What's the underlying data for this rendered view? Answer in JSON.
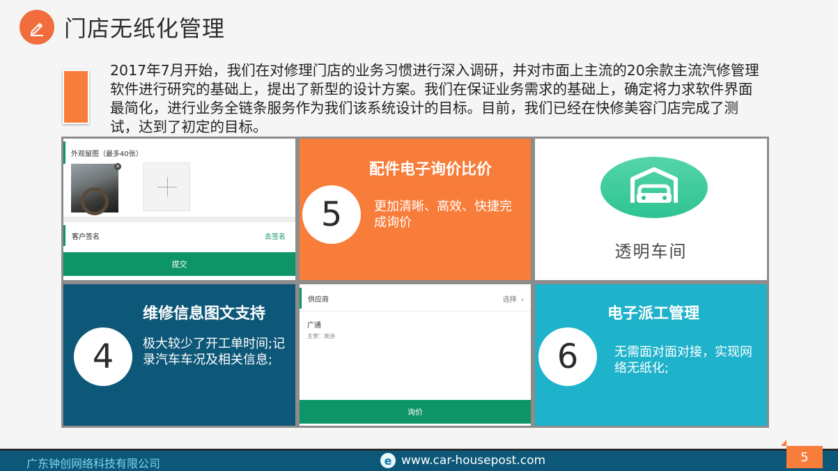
{
  "slide": {
    "title": "门店无纸化管理",
    "title_icon": "pencil-icon",
    "intro": "2017年7月开始，我们在对修理门店的业务习惯进行深入调研，并对市面上主流的20余款主流汽修管理软件进行研究的基础上，提出了新型的设计方案。我们在保证业务需求的基础上，确定将力求软件界面最简化，进行业务全链条服务作为我们该系统设计的目标。目前，我们已经在快修美容门店完成了测试，达到了初定的目标。",
    "accent_color": "#f87c3a",
    "dark_color": "#0d5878",
    "teal_color": "#1fb2cb",
    "green_color": "#0d9467"
  },
  "tiles": {
    "photo_form": {
      "header": "外观留图（最多40张）",
      "signature_label": "客户签名",
      "signature_link": "去签名",
      "submit": "提交"
    },
    "parts": {
      "number": "5",
      "title": "配件电子询价比价",
      "body": "更加清晰、高效、快捷完成询价"
    },
    "garage": {
      "icon": "garage-icon",
      "caption": "透明车间"
    },
    "repair": {
      "number": "4",
      "title": "维修信息图文支持",
      "body": "极大较少了开工单时间;记录汽车车况及相关信息;"
    },
    "supplier_form": {
      "header": "供应商",
      "choose": "选择",
      "supplier_name": "广通",
      "supplier_sub": "主营：奥迪",
      "inquiry": "询价"
    },
    "dispatch": {
      "number": "6",
      "title": "电子派工管理",
      "body": "无需面对面对接，实现网络无纸化;"
    }
  },
  "footer": {
    "company": "广东钟创网络科技有限公司",
    "url_icon": "e-icon",
    "url": "www.car-housepost.com",
    "page": "5"
  }
}
